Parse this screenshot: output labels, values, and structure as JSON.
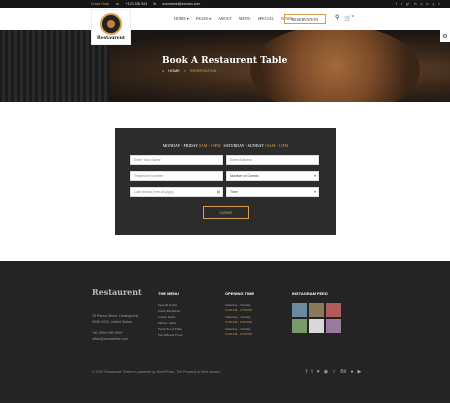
{
  "topbar": {
    "crave": "Crave Now!",
    "phone": "+123 185 543",
    "email": "username@domain.com",
    "socials": [
      "f",
      "t",
      "g+",
      "in",
      "p",
      "b",
      "y",
      "v"
    ]
  },
  "brand": {
    "name": "Restaurent"
  },
  "nav": {
    "items": [
      "HOME",
      "PAGES",
      "ABOUT",
      "MENU",
      "SPECIAL",
      "NEWS"
    ],
    "reservation": "RESERVATION",
    "cart_count": "0"
  },
  "hero": {
    "title": "Book A Restaurent Table",
    "crumb_home": "HOME",
    "crumb_sep": "»",
    "crumb_current": "RESERVATION"
  },
  "form": {
    "hours": "MONDAY - FRIDAY",
    "hours1_time": "8AM - 10PM",
    "hours2": "SATURDAY - SUNDAY",
    "hours2_time": "10AM - 11PM",
    "name_ph": "Enter Your Name",
    "email_ph": "Enter Address",
    "phone_ph": "Telephone Number",
    "guests": "Number of Guests",
    "date_ph": "Late format (mm-dd-yyyy)",
    "time": "Time",
    "submit": "SUBMIT"
  },
  "footer": {
    "logo": "Restaurent",
    "addr1": "15 Panna Street, Darlinghurst",
    "addr2": "NSW 2010, United States",
    "phone": "+61 9999 999 9999",
    "email": "office@domainlike.com",
    "menu_title": "THE MENU",
    "menu": [
      "Special Items",
      "Fresh Breakfast",
      "Lunch Items",
      "Dinner Items",
      "Fresh Food Time",
      "We Offered Food"
    ],
    "hours_title": "OPENING TIME",
    "hours": [
      {
        "d": "Saturday - Sunday",
        "t": "10:00 AM - 12:00 PM"
      },
      {
        "d": "Saturday - Sunday",
        "t": "10:00 AM - 03:00 PM"
      },
      {
        "d": "Saturday - Sunday",
        "t": "10:00 AM - 10:00 PM"
      }
    ],
    "insta_title": "INSTAGRAM FEED",
    "copy": "© 2016 Restaurant Theme is powered by WordPress. The Property of their owners.",
    "socials": [
      "f",
      "t",
      "♥",
      "◉",
      "✓",
      "Bē",
      "●",
      "▶"
    ]
  }
}
